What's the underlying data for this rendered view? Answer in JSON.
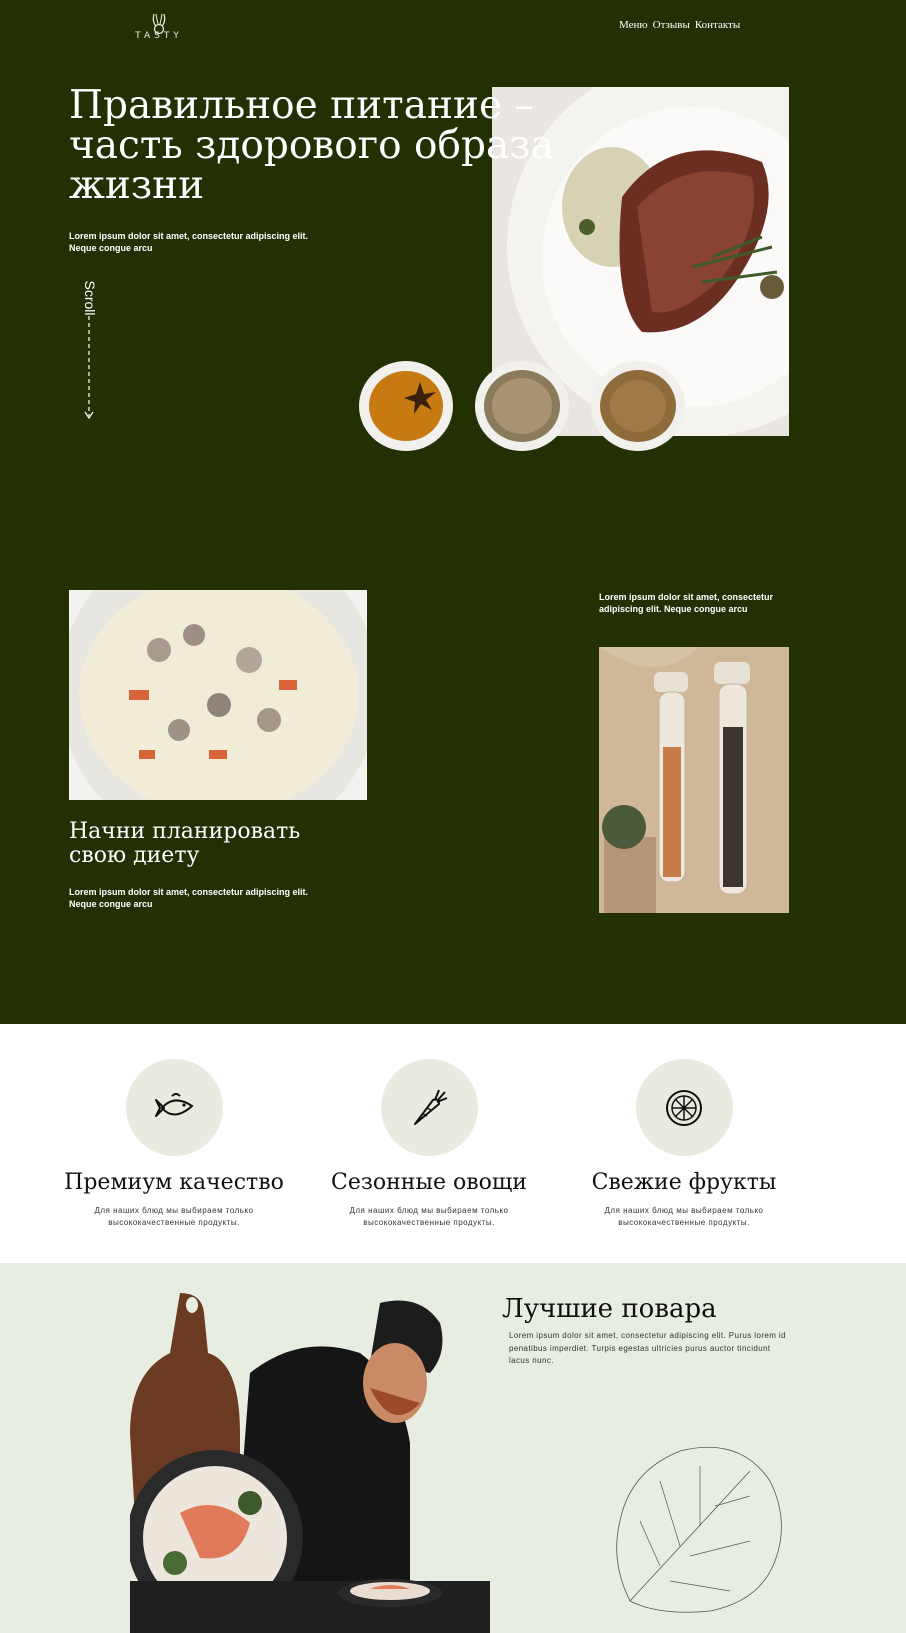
{
  "header": {
    "logo_text": "TASTY",
    "nav": [
      "Меню",
      "Отзывы",
      "Контакты"
    ]
  },
  "hero": {
    "title_lines": [
      "Правильное питание –",
      "часть здорового образа",
      "жизни"
    ],
    "subtitle": "Lorem ipsum dolor sit amet, consectetur adipiscing elit. Neque congue arcu",
    "scroll_label": "Scroll"
  },
  "diet": {
    "title_lines": [
      "Начни планировать",
      "свою диету"
    ],
    "subtitle": "Lorem ipsum dolor sit amet, consectetur adipiscing elit. Neque congue arcu",
    "right_text": "Lorem ipsum dolor sit amet, consectetur adipiscing elit. Neque congue arcu"
  },
  "features": [
    {
      "icon": "fish-icon",
      "title": "Премиум качество",
      "text": "Для наших блюд мы выбираем только высококачественные продукты."
    },
    {
      "icon": "carrot-icon",
      "title": "Сезонные овощи",
      "text": "Для наших блюд мы выбираем только высококачественные продукты."
    },
    {
      "icon": "fruit-slice-icon",
      "title": "Свежие фрукты",
      "text": "Для наших блюд мы выбираем только высококачественные продукты."
    }
  ],
  "chefs": {
    "title": "Лучшие повара",
    "text": "Lorem ipsum dolor sit amet, consectetur adipiscing elit. Purus lorem id penatibus imperdiet. Turpis egestas ultricies purus auctor tincidunt lacus nunc."
  },
  "colors": {
    "dark_green": "#223003",
    "light_sage": "#e8ece0",
    "white": "#ffffff"
  }
}
